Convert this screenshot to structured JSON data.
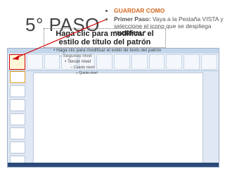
{
  "step": {
    "title": "5° PASO"
  },
  "bullets": [
    {
      "label": "GUARDAR COMO"
    },
    {
      "lead": "Primer Paso:",
      "text": " Vaya a la Pestaña VISTA y seleccione el icono que se despliega ",
      "strong": "“NORMAL”"
    }
  ],
  "slide": {
    "title_line1": "Haga clic para modificar el",
    "title_line2": "estilo de título del patrón",
    "level1": "• Haga clic para modificar el estilo de texto del patrón",
    "level2": "– Segundo nivel",
    "level3": "• Tercer nivel",
    "level4": "– Cuarto nivel",
    "level5": "» Quinto nivel"
  },
  "colors": {
    "accent": "#d2691e",
    "arrow": "#d00000"
  }
}
